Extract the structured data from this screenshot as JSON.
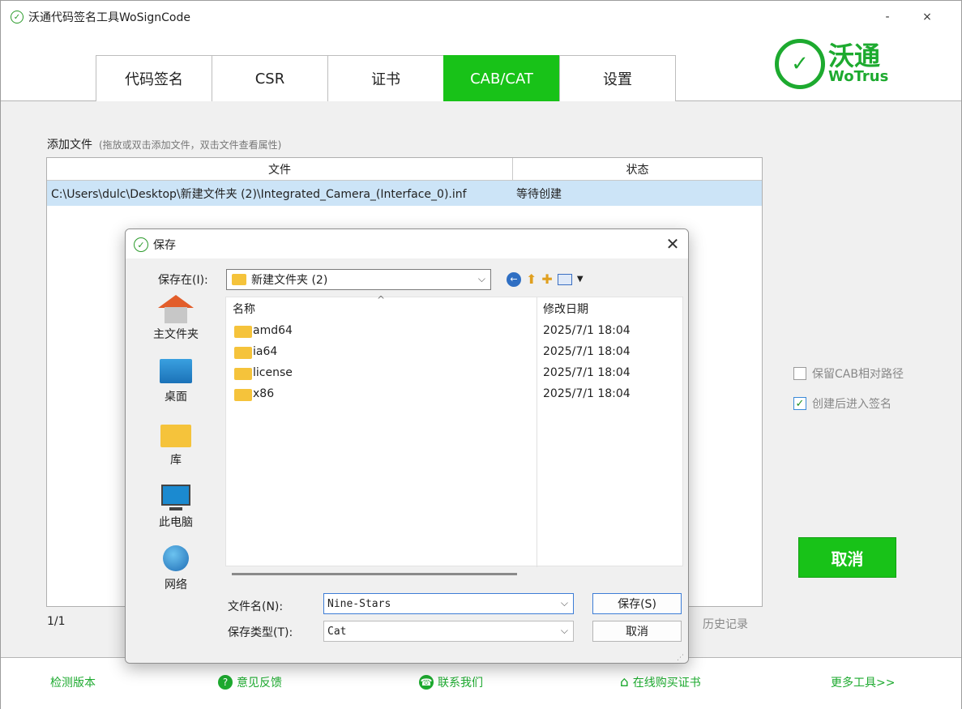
{
  "window": {
    "title": "沃通代码签名工具WoSignCode",
    "minimize": "-",
    "close": "×"
  },
  "tabs": [
    {
      "label": "代码签名"
    },
    {
      "label": "CSR"
    },
    {
      "label": "证书"
    },
    {
      "label": "CAB/CAT"
    },
    {
      "label": "设置"
    }
  ],
  "logo": {
    "cn": "沃通",
    "en": "WoTrus",
    "reg": "®"
  },
  "add_files": {
    "label": "添加文件",
    "hint": "(拖放或双击添加文件，双击文件查看属性)"
  },
  "file_table": {
    "headers": [
      "文件",
      "状态"
    ],
    "rows": [
      {
        "file": "C:\\Users\\dulc\\Desktop\\新建文件夹 (2)\\Integrated_Camera_(Interface_0).inf",
        "status": "等待创建"
      }
    ]
  },
  "count": "1/1",
  "history": "历史记录",
  "options": {
    "keep_cab_path": {
      "label": "保留CAB相对路径",
      "checked": false
    },
    "enter_sign": {
      "label": "创建后进入签名",
      "checked": true
    }
  },
  "cancel_big": "取消",
  "footer": {
    "check_version": "检测版本",
    "feedback": "意见反馈",
    "contact": "联系我们",
    "buy": "在线购买证书",
    "more_tools": "更多工具>>"
  },
  "dialog": {
    "title": "保存",
    "save_in_label": "保存在(I):",
    "save_in_value": "新建文件夹 (2)",
    "places": [
      "主文件夹",
      "桌面",
      "库",
      "此电脑",
      "网络"
    ],
    "columns": [
      "名称",
      "修改日期"
    ],
    "files": [
      {
        "name": "amd64",
        "date": "2025/7/1 18:04"
      },
      {
        "name": "ia64",
        "date": "2025/7/1 18:04"
      },
      {
        "name": "license",
        "date": "2025/7/1 18:04"
      },
      {
        "name": "x86",
        "date": "2025/7/1 18:04"
      }
    ],
    "filename_label": "文件名(N):",
    "filename_value": "Nine-Stars",
    "filetype_label": "保存类型(T):",
    "filetype_value": "Cat",
    "save_button": "保存(S)",
    "cancel_button": "取消"
  },
  "colors": {
    "accent": "#18c218",
    "selection": "#cce4f7"
  }
}
